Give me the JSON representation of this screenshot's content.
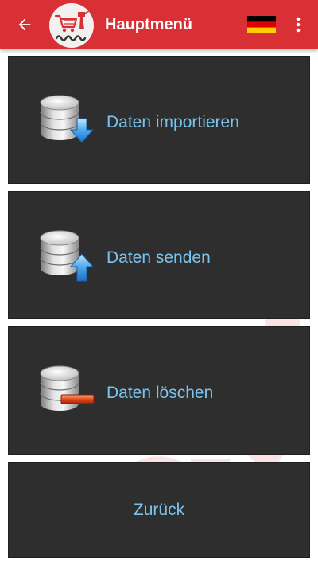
{
  "app_bar": {
    "title": "Hauptmenü",
    "colors": {
      "background": "#d93036",
      "text": "#ffffff"
    },
    "icons": {
      "back": "arrow-left-icon",
      "logo": "shop-logo",
      "language": "german-flag-icon",
      "overflow": "more-vert-icon"
    }
  },
  "menu": {
    "items": [
      {
        "id": "import",
        "label": "Daten importieren",
        "icon": "database-download-icon"
      },
      {
        "id": "send",
        "label": "Daten senden",
        "icon": "database-upload-icon"
      },
      {
        "id": "delete",
        "label": "Daten löschen",
        "icon": "database-delete-icon"
      },
      {
        "id": "back",
        "label": "Zurück"
      }
    ],
    "colors": {
      "card": "#2e2e2e",
      "label": "#78c4ee"
    }
  }
}
